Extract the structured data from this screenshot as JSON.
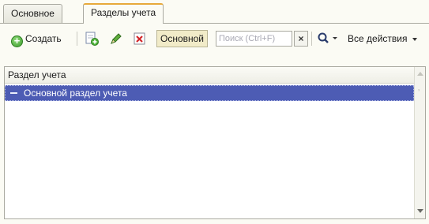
{
  "tabs": [
    {
      "label": "Основное",
      "active": false
    },
    {
      "label": "Разделы учета",
      "active": true
    }
  ],
  "toolbar": {
    "create_label": "Создать",
    "add_copy_icon": "add-copy-icon",
    "edit_icon": "pencil-icon",
    "delete_icon": "delete-x-icon",
    "toggle_label": "Основной",
    "search_placeholder": "Поиск (Ctrl+F)",
    "search_clear": "×",
    "search_icon": "magnifier-icon",
    "all_actions_label": "Все действия"
  },
  "table": {
    "columns": [
      "Раздел учета"
    ],
    "rows": [
      {
        "label": "Основной раздел учета",
        "selected": true
      }
    ]
  },
  "colors": {
    "selection": "#4d5cb4",
    "active_tab_accent": "#e7a93a",
    "create_green": "#3c9a2c"
  }
}
